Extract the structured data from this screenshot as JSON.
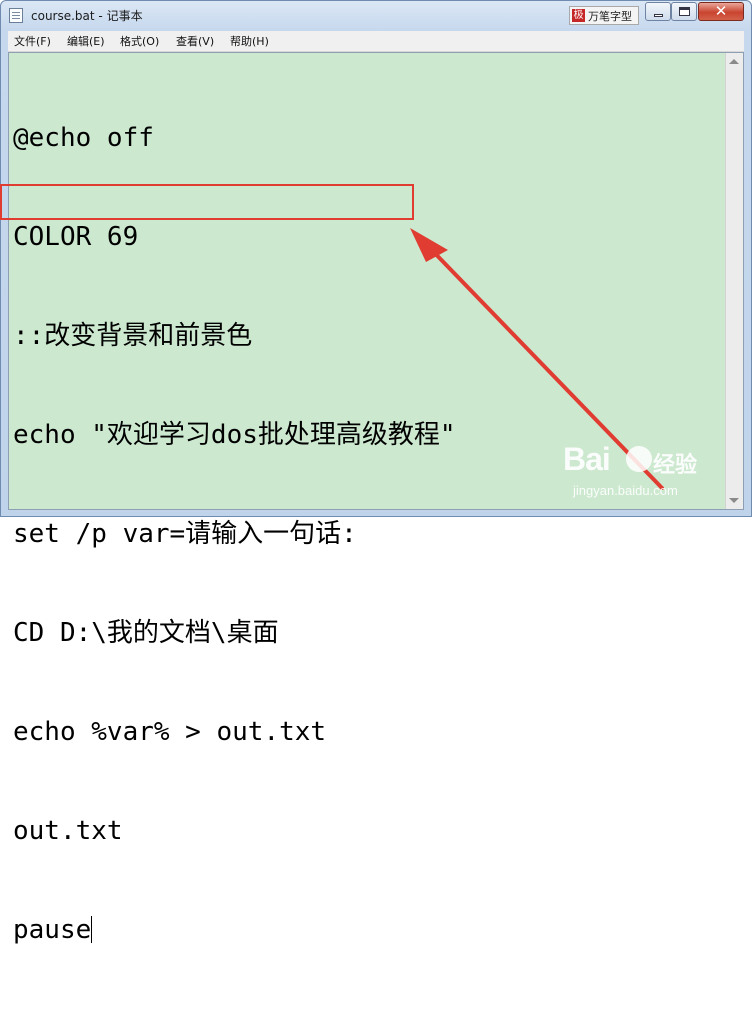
{
  "window": {
    "title": "course.bat - 记事本",
    "ime_label": "万笔字型",
    "ime_logo": "极",
    "close_glyph": "✕"
  },
  "menu": [
    {
      "label": "文件(F)"
    },
    {
      "label": "编辑(E)"
    },
    {
      "label": "格式(O)"
    },
    {
      "label": "查看(V)"
    },
    {
      "label": "帮助(H)"
    }
  ],
  "editor": {
    "background": "#cce8cf",
    "lines": [
      "@echo off",
      "COLOR 69",
      "::改变背景和前景色",
      "echo \"欢迎学习dos批处理高级教程\"",
      "set /p var=请输入一句话:",
      "CD D:\\我的文档\\桌面",
      "echo %var% > out.txt",
      "out.txt",
      "pause"
    ]
  },
  "annotation": {
    "color": "#e03c31",
    "highlighted_line": 5
  },
  "watermark": {
    "brand_left": "Bai",
    "brand_right": "经验",
    "url": "jingyan.baidu.com"
  }
}
